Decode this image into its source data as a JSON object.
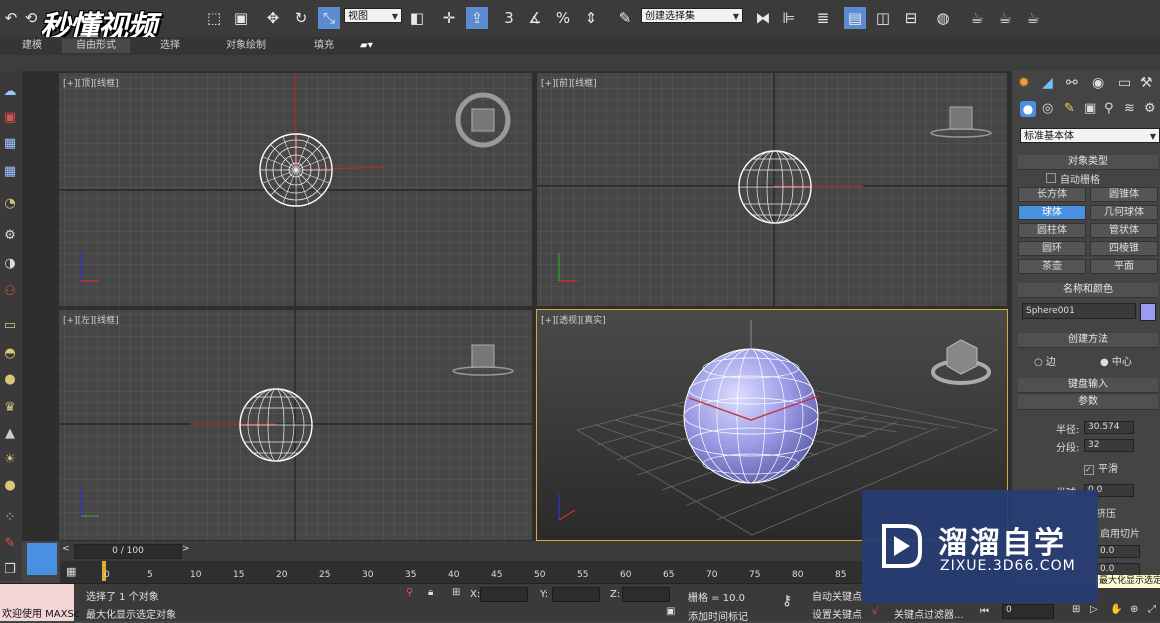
{
  "watermark_top": "秒懂视频",
  "toolbar": {
    "view_dropdown": "视图",
    "selection_set_dropdown": "创建选择集"
  },
  "ribbon": {
    "tabs": [
      "建模",
      "自由形式",
      "选择",
      "对象绘制",
      "填充"
    ]
  },
  "viewports": {
    "top_label": "[+][顶][线框]",
    "front_label": "[+][前][线框]",
    "left_label": "[+][左][线框]",
    "persp_label": "[+][透视][真实]"
  },
  "command_panel": {
    "category_dropdown": "标准基本体",
    "object_type_header": "对象类型",
    "auto_grid": "自动栅格",
    "primitives": [
      "长方体",
      "圆锥体",
      "球体",
      "几何球体",
      "圆柱体",
      "管状体",
      "圆环",
      "四棱锥",
      "茶壶",
      "平面"
    ],
    "active_primitive": "球体",
    "name_color_header": "名称和颜色",
    "object_name": "Sphere001",
    "object_color": "#9b9bf0",
    "creation_method_header": "创建方法",
    "edge_option": "边",
    "center_option": "中心",
    "keyboard_input_header": "键盘输入",
    "params_header": "参数",
    "radius_label": "半径:",
    "radius_value": "30.574",
    "segments_label": "分段:",
    "segments_value": "32",
    "smooth_label": "平滑",
    "hemisphere_label": "半球",
    "hemisphere_value": "0.0",
    "squash_label": "挤压",
    "slice_label": "启用切片",
    "slice_from": "0.0",
    "slice_to": "0.0",
    "tooltip": "最大化显示选定对象"
  },
  "timeline": {
    "frame_display": "0 / 100",
    "ticks": [
      "0",
      "5",
      "10",
      "15",
      "20",
      "25",
      "30",
      "35",
      "40",
      "45",
      "50",
      "55",
      "60",
      "65",
      "70",
      "75",
      "80",
      "85"
    ]
  },
  "status": {
    "welcome": "欢迎使用 MAXSc",
    "selected_text": "选择了 1 个对象",
    "prompt_text": "最大化显示选定对象",
    "x_label": "X:",
    "y_label": "Y:",
    "z_label": "Z:",
    "grid_text": "栅格 = 10.0",
    "add_time_tag": "添加时间标记",
    "auto_key": "自动关键点",
    "set_key": "设置关键点",
    "key_filter": "关键点过滤器...",
    "frame_value": "0"
  },
  "watermark_brand": {
    "name": "溜溜自学",
    "url": "ZIXUE.3D66.COM"
  }
}
